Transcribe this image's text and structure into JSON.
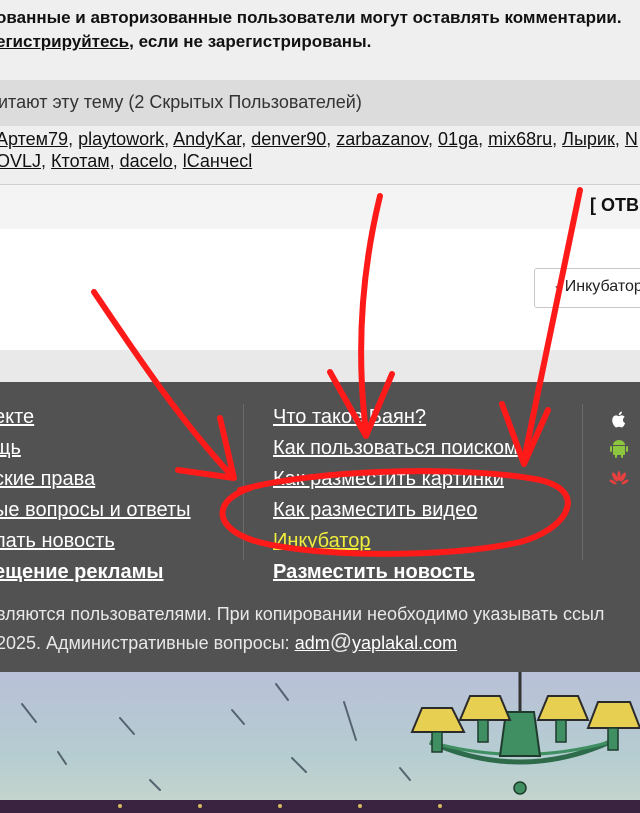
{
  "notice": {
    "line1": "ованные и авторизованные пользователи могут оставлять комментарии.",
    "line2_link": "егистрируйтесь",
    "line2_rest": ", если не зарегистрированы."
  },
  "readers": {
    "heading": "итают эту тему (2 Скрытых Пользователей)",
    "row1": [
      "Артем79",
      "playtowork",
      "AndyKar",
      "denver90",
      "zarbazanov",
      "01ga",
      "mix68ru",
      "Лырик",
      "N"
    ],
    "row2": [
      "OVLJ",
      "Ктотам",
      "dacelo",
      "lСанчесl"
    ]
  },
  "reply_button": "[ ОТВЕ",
  "forum_select": {
    "value": "- Инкубатор"
  },
  "footer": {
    "left_links": [
      "екте",
      "щь",
      "ские права",
      "ые вопросы и ответы",
      "лать новость",
      "ещение рекламы"
    ],
    "mid_links": [
      "Что такое Баян?",
      "Как пользоваться поиском",
      "Как разместить картинки",
      "Как разместить видео",
      "Инкубатор",
      "Разместить новость"
    ],
    "os_icons": [
      "apple-icon",
      "android-icon",
      "huawei-icon"
    ],
    "copyright_line1": "вляются пользователями. При копировании необходимо указывать ссыл",
    "copyright_line2_prefix": "2025. Административные вопросы: ",
    "email_user": "adm",
    "email_at": "@",
    "email_domain": "yaplakal.com"
  },
  "colors": {
    "footer_bg": "#525252",
    "link_yellow": "#f1ee3b",
    "annotation_red": "#ff1a1a"
  }
}
